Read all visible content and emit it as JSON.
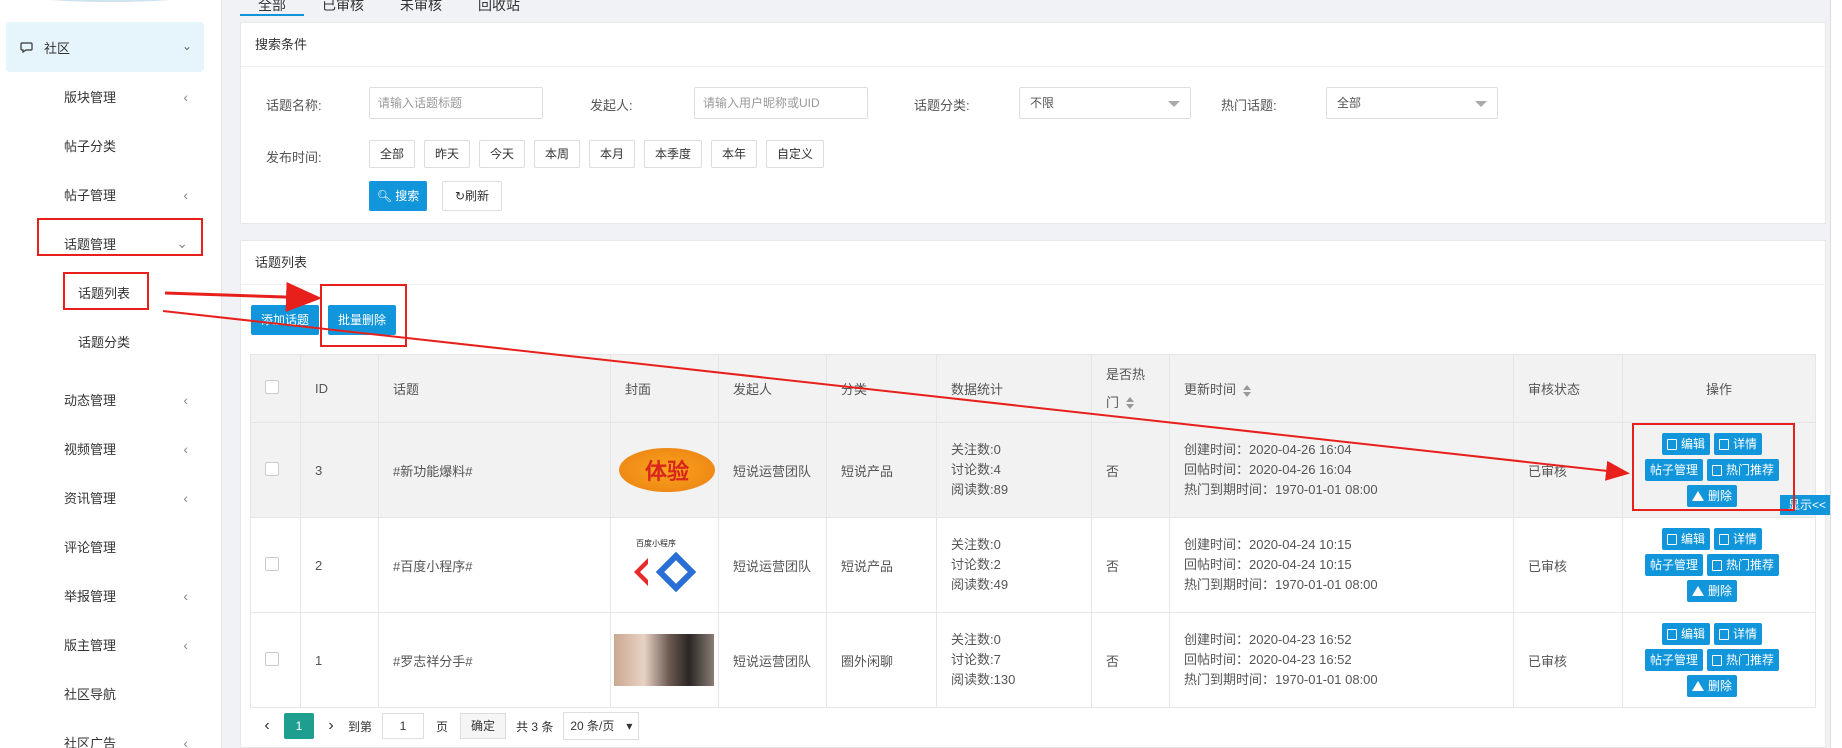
{
  "sidebar": {
    "group_label": "社区",
    "items": [
      {
        "label": "版块管理",
        "chev": "‹"
      },
      {
        "label": "帖子分类",
        "chev": ""
      },
      {
        "label": "帖子管理",
        "chev": "‹"
      },
      {
        "label": "话题管理",
        "chev": "⌄"
      },
      {
        "label": "话题列表",
        "chev": ""
      },
      {
        "label": "话题分类",
        "chev": ""
      },
      {
        "label": "动态管理",
        "chev": "‹"
      },
      {
        "label": "视频管理",
        "chev": "‹"
      },
      {
        "label": "资讯管理",
        "chev": "‹"
      },
      {
        "label": "评论管理",
        "chev": ""
      },
      {
        "label": "举报管理",
        "chev": "‹"
      },
      {
        "label": "版主管理",
        "chev": "‹"
      },
      {
        "label": "社区导航",
        "chev": ""
      },
      {
        "label": "社区广告",
        "chev": "‹"
      }
    ]
  },
  "tabs": [
    "全部",
    "已审核",
    "未审核",
    "回收站"
  ],
  "search": {
    "title": "搜索条件",
    "topic_name_label": "话题名称:",
    "topic_name_placeholder": "请输入话题标题",
    "initiator_label": "发起人:",
    "initiator_placeholder": "请输入用户昵称或UID",
    "category_label": "话题分类:",
    "category_value": "不限",
    "hot_label": "热门话题:",
    "hot_value": "全部",
    "time_label": "发布时间:",
    "time_chips": [
      "全部",
      "昨天",
      "今天",
      "本周",
      "本月",
      "本季度",
      "本年",
      "自定义"
    ],
    "search_btn": "搜索",
    "refresh_btn": "刷新"
  },
  "list": {
    "title": "话题列表",
    "add_btn": "添加话题",
    "batch_delete_btn": "批量删除",
    "columns": [
      "ID",
      "话题",
      "封面",
      "发起人",
      "分类",
      "数据统计",
      "是否热门",
      "更新时间",
      "审核状态",
      "操作"
    ],
    "hot_col_line1": "是否热",
    "hot_col_line2": "门",
    "rows": [
      {
        "id": "3",
        "topic": "#新功能爆料#",
        "cover": "体验",
        "initiator": "短说运营团队",
        "category": "短说产品",
        "follow": "关注数:0",
        "discuss": "讨论数:4",
        "read": "阅读数:89",
        "hot": "否",
        "created": "创建时间：2020-04-26 16:04",
        "replied": "回帖时间：2020-04-26 16:04",
        "hot_expire": "热门到期时间：1970-01-01 08:00",
        "status": "已审核"
      },
      {
        "id": "2",
        "topic": "#百度小程序#",
        "cover": "百度小程序",
        "initiator": "短说运营团队",
        "category": "短说产品",
        "follow": "关注数:0",
        "discuss": "讨论数:2",
        "read": "阅读数:49",
        "hot": "否",
        "created": "创建时间：2020-04-24 10:15",
        "replied": "回帖时间：2020-04-24 10:15",
        "hot_expire": "热门到期时间：1970-01-01 08:00",
        "status": "已审核"
      },
      {
        "id": "1",
        "topic": "#罗志祥分手#",
        "cover": "",
        "initiator": "短说运营团队",
        "category": "圈外闲聊",
        "follow": "关注数:0",
        "discuss": "讨论数:7",
        "read": "阅读数:130",
        "hot": "否",
        "created": "创建时间：2020-04-23 16:52",
        "replied": "回帖时间：2020-04-23 16:52",
        "hot_expire": "热门到期时间：1970-01-01 08:00",
        "status": "已审核"
      }
    ],
    "ops": {
      "edit": "编辑",
      "detail": "详情",
      "posts": "帖子管理",
      "recommend": "热门推荐",
      "delete": "删除"
    }
  },
  "pager": {
    "prev": "‹",
    "current": "1",
    "next": "›",
    "goto_label": "到第",
    "goto_value": "1",
    "page_label": "页",
    "confirm": "确定",
    "total": "共 3 条",
    "page_size": "20 条/页"
  },
  "show_badge": "显示<<",
  "colors": {
    "primary": "#1296db",
    "annotation": "#e8201c"
  }
}
